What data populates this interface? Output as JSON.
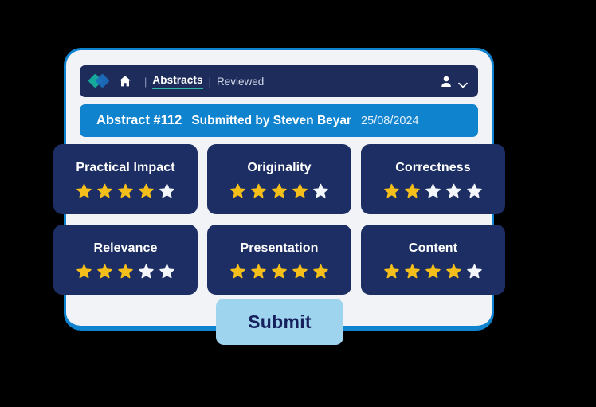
{
  "navbar": {
    "logo_icon": "double-diamond-logo",
    "home_icon": "home-icon",
    "separator": "|",
    "active_link": "Abstracts",
    "secondary_link": "Reviewed",
    "user_icon": "user-icon",
    "chevron_icon": "chevron-down-icon"
  },
  "banner": {
    "abstract_id": "Abstract #112",
    "submitted_by": "Submitted by Steven Beyar",
    "date": "25/08/2024"
  },
  "ratings": [
    {
      "label": "Practical Impact",
      "filled": 4,
      "total": 5
    },
    {
      "label": "Originality",
      "filled": 4,
      "total": 5
    },
    {
      "label": "Correctness",
      "filled": 2,
      "total": 5
    },
    {
      "label": "Relevance",
      "filled": 3,
      "total": 5
    },
    {
      "label": "Presentation",
      "filled": 5,
      "total": 5
    },
    {
      "label": "Content",
      "filled": 4,
      "total": 5
    }
  ],
  "submit": {
    "label": "Submit"
  },
  "colors": {
    "background": "#000000",
    "frame_border": "#1083cf",
    "frame_fill": "#f1f3f6",
    "navbar": "#1e2c5c",
    "card": "#1c2e63",
    "banner": "#1083cf",
    "star_filled": "#f4bf1b",
    "star_empty": "#f3f6fa",
    "submit_bg": "#9fd4ee",
    "submit_text": "#16205c",
    "accent_underline": "#2fb8a8",
    "logo_teal": "#16a89a",
    "logo_blue": "#1b6fbd"
  }
}
